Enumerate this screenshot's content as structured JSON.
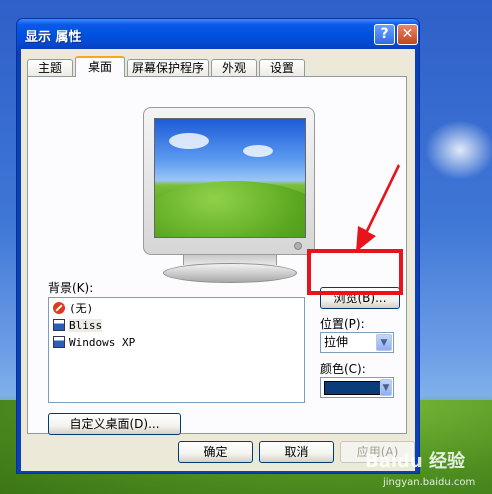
{
  "window": {
    "title": "显示 属性",
    "help_label": "?",
    "close_label": "✕"
  },
  "tabs": [
    {
      "label": "主题",
      "active": false
    },
    {
      "label": "桌面",
      "active": true
    },
    {
      "label": "屏幕保护程序",
      "active": false
    },
    {
      "label": "外观",
      "active": false
    },
    {
      "label": "设置",
      "active": false
    }
  ],
  "background": {
    "label": "背景(K):",
    "items": [
      {
        "label": "(无)",
        "icon": "none-icon"
      },
      {
        "label": "Bliss",
        "icon": "image-icon",
        "selected": true
      },
      {
        "label": "Windows XP",
        "icon": "image-icon"
      }
    ]
  },
  "browse_button": "浏览(B)...",
  "position": {
    "label": "位置(P):",
    "value": "拉伸"
  },
  "color": {
    "label": "颜色(C):",
    "value": "#0a3c7a"
  },
  "customize_button": "自定义桌面(D)...",
  "footer": {
    "ok": "确定",
    "cancel": "取消",
    "apply": "应用(A)"
  },
  "annotation": {
    "highlight_color": "#e8141c"
  },
  "watermark": {
    "logo": "Baidu 经验",
    "url": "jingyan.baidu.com"
  }
}
